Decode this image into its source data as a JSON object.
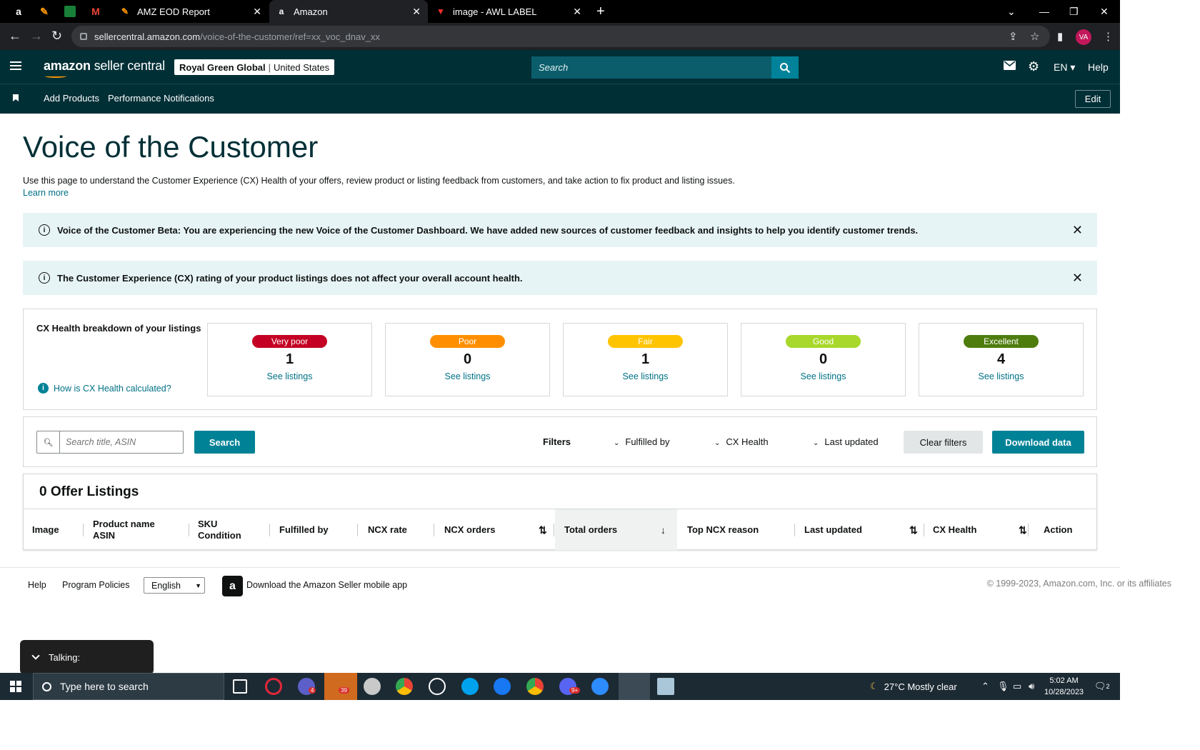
{
  "browser": {
    "tabs": [
      {
        "title": "AMZ EOD Report",
        "active": false
      },
      {
        "title": "Amazon",
        "active": true
      },
      {
        "title": "image - AWL LABEL",
        "active": false
      }
    ],
    "url_host": "sellercentral.amazon.com",
    "url_path": "/voice-of-the-customer/ref=xx_voc_dnav_xx",
    "profile_initials": "VA"
  },
  "header": {
    "logo_bold": "amazon",
    "logo_rest": " seller central",
    "store_name": "Royal Green Global",
    "marketplace": "United States",
    "search_placeholder": "Search",
    "language": "EN",
    "help": "Help"
  },
  "bookmarks": {
    "links": [
      "Add Products",
      "Performance Notifications"
    ],
    "edit": "Edit"
  },
  "page": {
    "title": "Voice of the Customer",
    "description": "Use this page to understand the Customer Experience (CX) Health of your offers, review product or listing feedback from customers, and take action to fix product and listing issues.",
    "learn_more": "Learn more"
  },
  "alerts": [
    {
      "text": "Voice of the Customer Beta: You are experiencing the new Voice of the Customer Dashboard. We have added new sources of customer feedback and insights to help you identify customer trends."
    },
    {
      "text": "The Customer Experience (CX) rating of your product listings does not affect your overall account health."
    }
  ],
  "cx_health": {
    "title": "CX Health breakdown of your listings",
    "how_link": "How is CX Health calculated?",
    "cards": [
      {
        "label": "Very poor",
        "count": "1",
        "link": "See listings",
        "color": "#c40024",
        "text_color": "#ffffff"
      },
      {
        "label": "Poor",
        "count": "0",
        "link": "See listings",
        "color": "#ff8f00",
        "text_color": "#ffffff"
      },
      {
        "label": "Fair",
        "count": "1",
        "link": "See listings",
        "color": "#ffc400",
        "text_color": "#ffffff"
      },
      {
        "label": "Good",
        "count": "0",
        "link": "See listings",
        "color": "#a8d82b",
        "text_color": "#ffffff"
      },
      {
        "label": "Excellent",
        "count": "4",
        "link": "See listings",
        "color": "#4e7d0e",
        "text_color": "#ffffff"
      }
    ]
  },
  "filters": {
    "search_placeholder": "Search title, ASIN",
    "search_button": "Search",
    "filters_label": "Filters",
    "fulfilled_by": "Fulfilled by",
    "cx_health": "CX Health",
    "last_updated": "Last updated",
    "clear": "Clear filters",
    "download": "Download data"
  },
  "listings": {
    "title": "0 Offer Listings",
    "columns": [
      {
        "line1": "Image",
        "line2": ""
      },
      {
        "line1": "Product name",
        "line2": "ASIN"
      },
      {
        "line1": "SKU",
        "line2": "Condition"
      },
      {
        "line1": "Fulfilled by",
        "line2": ""
      },
      {
        "line1": "NCX rate",
        "line2": ""
      },
      {
        "line1": "NCX orders",
        "line2": ""
      },
      {
        "line1": "Total orders",
        "line2": ""
      },
      {
        "line1": "Top NCX reason",
        "line2": ""
      },
      {
        "line1": "Last updated",
        "line2": ""
      },
      {
        "line1": "CX Health",
        "line2": ""
      },
      {
        "line1": "Action",
        "line2": ""
      }
    ]
  },
  "footer": {
    "help": "Help",
    "policies": "Program Policies",
    "language": "English",
    "app_text": "Download the Amazon Seller mobile app",
    "copyright": "© 1999-2023, Amazon.com, Inc. or its affiliates"
  },
  "overlay": {
    "talking": "Talking:"
  },
  "taskbar": {
    "search_placeholder": "Type here to search",
    "weather": "27°C  Mostly clear",
    "time": "5:02 AM",
    "date": "10/28/2023",
    "badge_a": "4",
    "badge_b": "39",
    "badge_c": "9+",
    "notif_count": "2"
  }
}
